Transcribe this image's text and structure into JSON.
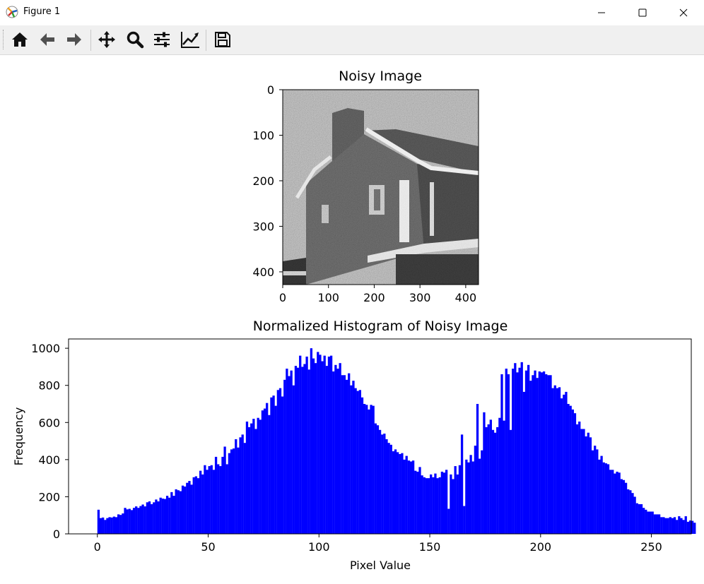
{
  "window": {
    "title": "Figure 1"
  },
  "toolbar": {
    "buttons": [
      "home-icon",
      "back-icon",
      "forward-icon",
      "pan-icon",
      "zoom-icon",
      "configure-subplots-icon",
      "edit-axis-icon",
      "save-icon"
    ]
  },
  "colors": {
    "histogram_bar": "#0000ff",
    "toolbar_bg": "#f0f0f0"
  },
  "chart_data": [
    {
      "type": "image",
      "title": "Noisy Image",
      "xticks": [
        "0",
        "100",
        "200",
        "300",
        "400"
      ],
      "yticks": [
        "0",
        "100",
        "200",
        "300",
        "400"
      ],
      "xlim": [
        0,
        428
      ],
      "ylim": [
        428,
        0
      ],
      "colormap": "gray"
    },
    {
      "type": "bar",
      "title": "Normalized Histogram of Noisy Image",
      "xlabel": "Pixel Value",
      "ylabel": "Frequency",
      "xticks": [
        "0",
        "50",
        "100",
        "150",
        "200",
        "250"
      ],
      "yticks": [
        "0",
        "200",
        "400",
        "600",
        "800",
        "1000"
      ],
      "xlim": [
        -13,
        268
      ],
      "ylim": [
        0,
        1050
      ],
      "x_start": 0,
      "bin_width": 1,
      "values": [
        130,
        85,
        88,
        75,
        85,
        90,
        88,
        93,
        90,
        105,
        102,
        110,
        140,
        132,
        135,
        128,
        140,
        148,
        140,
        150,
        158,
        148,
        170,
        175,
        160,
        170,
        185,
        175,
        195,
        190,
        188,
        205,
        195,
        225,
        205,
        240,
        235,
        230,
        260,
        255,
        275,
        285,
        265,
        305,
        310,
        300,
        340,
        320,
        370,
        345,
        365,
        370,
        345,
        415,
        375,
        365,
        415,
        470,
        375,
        435,
        455,
        460,
        510,
        465,
        520,
        535,
        490,
        605,
        575,
        595,
        620,
        565,
        625,
        615,
        665,
        675,
        705,
        640,
        735,
        745,
        690,
        775,
        785,
        740,
        830,
        890,
        850,
        880,
        800,
        905,
        895,
        960,
        900,
        915,
        955,
        885,
        1000,
        945,
        920,
        980,
        965,
        930,
        960,
        905,
        955,
        960,
        875,
        910,
        890,
        920,
        855,
        855,
        830,
        865,
        800,
        825,
        785,
        770,
        775,
        735,
        700,
        695,
        670,
        695,
        690,
        595,
        585,
        560,
        535,
        540,
        510,
        490,
        480,
        445,
        455,
        440,
        430,
        435,
        400,
        420,
        395,
        390,
        395,
        340,
        335,
        360,
        315,
        305,
        300,
        300,
        320,
        305,
        325,
        300,
        305,
        335,
        330,
        345,
        135,
        320,
        295,
        365,
        320,
        370,
        535,
        150,
        400,
        385,
        425,
        390,
        475,
        700,
        405,
        450,
        655,
        575,
        590,
        615,
        560,
        545,
        575,
        625,
        860,
        610,
        890,
        860,
        560,
        890,
        920,
        870,
        895,
        925,
        765,
        880,
        910,
        825,
        855,
        880,
        840,
        875,
        870,
        875,
        860,
        855,
        855,
        785,
        800,
        785,
        790,
        730,
        750,
        765,
        700,
        690,
        670,
        650,
        590,
        605,
        565,
        565,
        525,
        545,
        520,
        450,
        475,
        455,
        400,
        420,
        385,
        380,
        375,
        345,
        345,
        325,
        335,
        330,
        295,
        290,
        275,
        240,
        235,
        220,
        200,
        165,
        160,
        160,
        140,
        130,
        120,
        120,
        120,
        105,
        105,
        105,
        90,
        90,
        85,
        85,
        90,
        85,
        90,
        75,
        95,
        85,
        75,
        95,
        65,
        72,
        70,
        60
      ]
    }
  ]
}
